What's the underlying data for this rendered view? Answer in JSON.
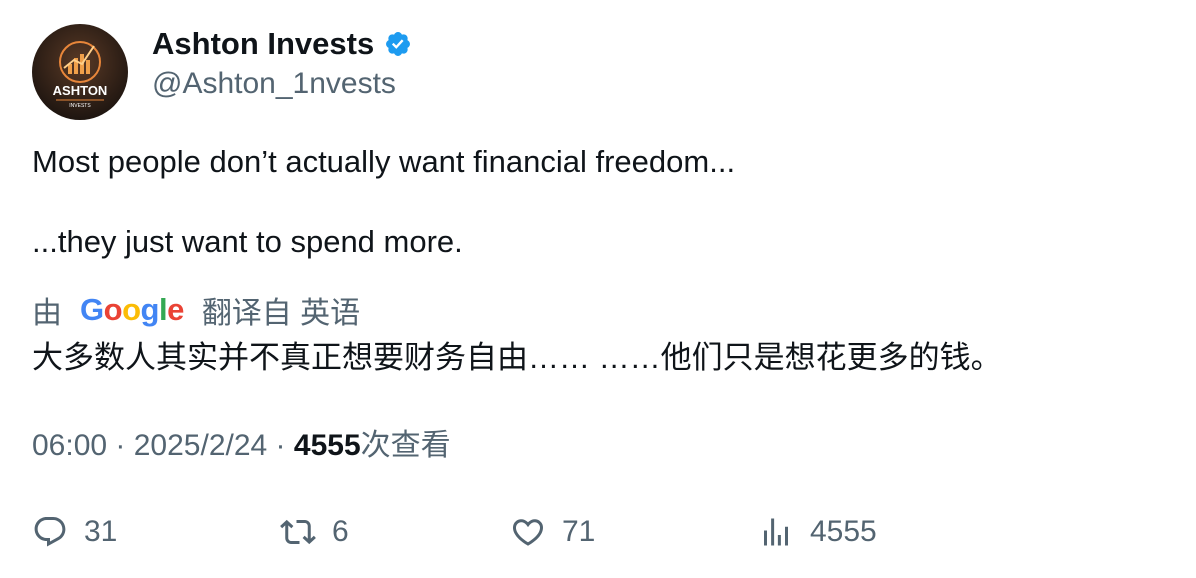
{
  "author": {
    "display_name": "Ashton Invests",
    "handle": "@Ashton_1nvests",
    "avatar_text": "ASHTON",
    "avatar_subtext": "INVESTS",
    "verified_icon": "verified-badge-icon"
  },
  "tweet": {
    "line1": "Most people don’t actually want financial freedom...",
    "line2": "...they just want to spend more."
  },
  "translation": {
    "by_label": "由",
    "google_letters": [
      "G",
      "o",
      "o",
      "g",
      "l",
      "e"
    ],
    "translated_from": "翻译自 英语",
    "text": "大多数人其实并不真正想要财务自由…… ……他们只是想花更多的钱。"
  },
  "meta": {
    "time": "06:00",
    "separator": " · ",
    "date": "2025/2/24",
    "views_count": "4555",
    "views_label": "次查看"
  },
  "actions": {
    "reply": {
      "icon": "reply-icon",
      "count": "31"
    },
    "retweet": {
      "icon": "retweet-icon",
      "count": "6"
    },
    "like": {
      "icon": "heart-icon",
      "count": "71"
    },
    "views": {
      "icon": "analytics-icon",
      "count": "4555"
    }
  },
  "colors": {
    "text_primary": "#0f1419",
    "text_secondary": "#536471",
    "verified_blue": "#1d9bf0",
    "google_blue": "#4285f4",
    "google_red": "#ea4335",
    "google_yellow": "#fbbc05",
    "google_green": "#34a853"
  }
}
